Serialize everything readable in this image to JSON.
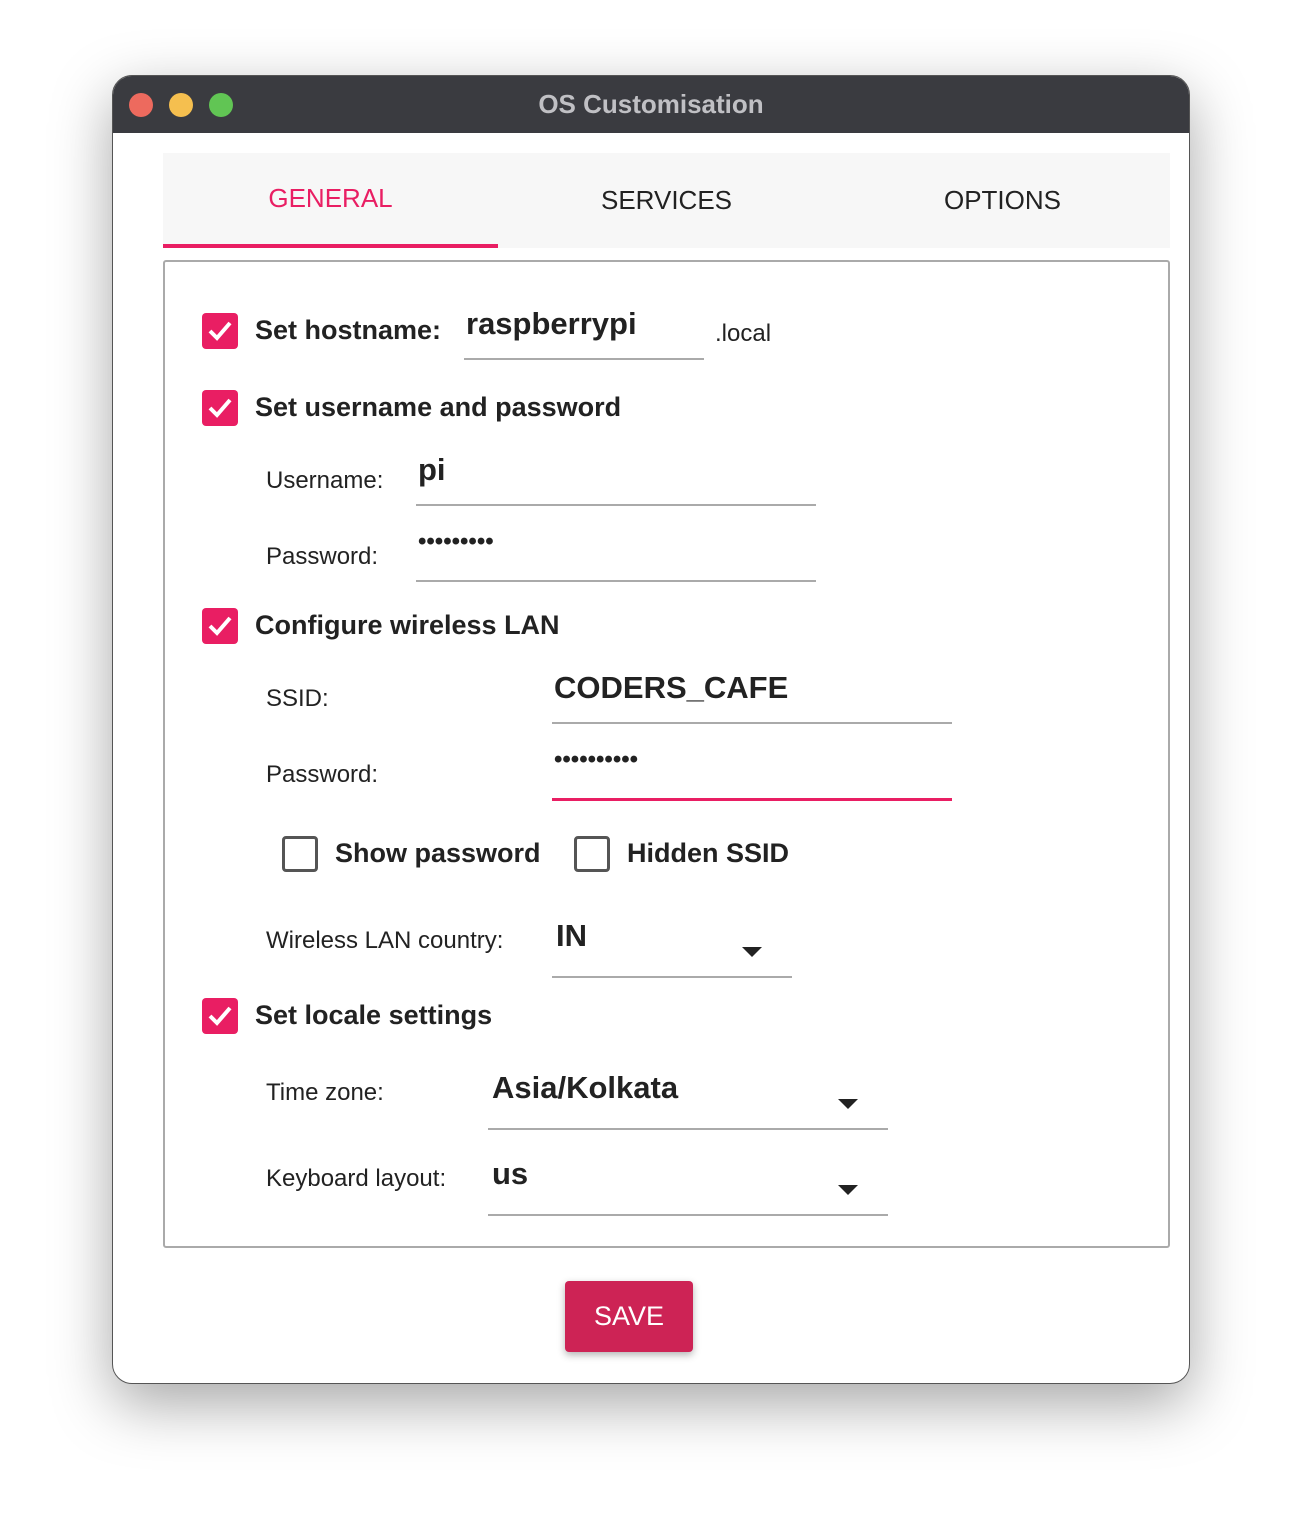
{
  "window": {
    "title": "OS Customisation",
    "controls": {
      "close": "#ed6a5e",
      "minimize": "#f5bf4f",
      "zoom": "#61c554"
    }
  },
  "accent": "#e91e63",
  "tabs": [
    {
      "label": "GENERAL",
      "active": true
    },
    {
      "label": "SERVICES"
    },
    {
      "label": "OPTIONS"
    }
  ],
  "general": {
    "hostname": {
      "checked": true,
      "label": "Set hostname:",
      "value": "raspberrypi",
      "suffix": ".local"
    },
    "user": {
      "checked": true,
      "label": "Set username and password",
      "username_label": "Username:",
      "username": "pi",
      "password_label": "Password:",
      "password": "•••••••••"
    },
    "wlan": {
      "checked": true,
      "label": "Configure wireless LAN",
      "ssid_label": "SSID:",
      "ssid": "CODERS_CAFE",
      "password_label": "Password:",
      "password": "••••••••••",
      "show_password": {
        "label": "Show password",
        "checked": false
      },
      "hidden_ssid": {
        "label": "Hidden SSID",
        "checked": false
      },
      "country_label": "Wireless LAN country:",
      "country": "IN"
    },
    "locale": {
      "checked": true,
      "label": "Set locale settings",
      "timezone_label": "Time zone:",
      "timezone": "Asia/Kolkata",
      "keyboard_label": "Keyboard layout:",
      "keyboard": "us"
    }
  },
  "save_label": "SAVE"
}
